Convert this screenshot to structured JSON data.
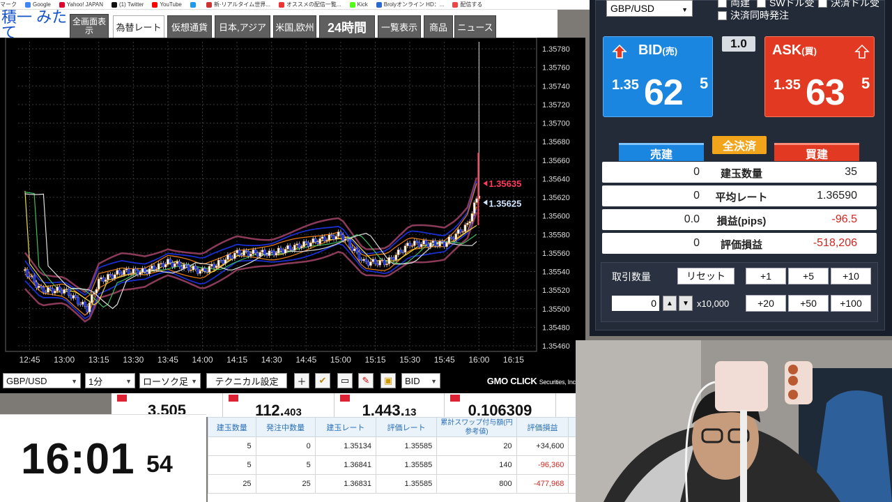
{
  "bookmarks": [
    "マーク",
    "Google",
    "Yahoo! JAPAN",
    "(1) Twitter",
    "YouTube",
    "新·リアルタイム世界...",
    "オススメの配信一覧...",
    "Kick",
    "Brolyオンライン HD：...",
    "配信する"
  ],
  "left_strip_text": "積一 みたて",
  "tabs": [
    {
      "label": "全画面表示"
    },
    {
      "label": "為替レート",
      "active": true
    },
    {
      "label": "仮想通貨"
    },
    {
      "label": "日本,アジア"
    },
    {
      "label": "米国,欧州"
    },
    {
      "label": "24時間"
    },
    {
      "label": "一覧表示"
    },
    {
      "label": "商品"
    },
    {
      "label": "ニュース"
    }
  ],
  "chart": {
    "y_ticks": [
      "1.35780",
      "1.35760",
      "1.35740",
      "1.35720",
      "1.35700",
      "1.35680",
      "1.35660",
      "1.35640",
      "1.35620",
      "1.35600",
      "1.35580",
      "1.35560",
      "1.35540",
      "1.35520",
      "1.35500",
      "1.35480",
      "1.35460"
    ],
    "x_ticks": [
      "12:45",
      "13:00",
      "13:15",
      "13:30",
      "13:45",
      "14:00",
      "14:15",
      "14:30",
      "14:45",
      "15:00",
      "15:15",
      "15:30",
      "15:45",
      "16:00",
      "16:15"
    ],
    "ask_label": "1.35635",
    "bid_label": "1.35625"
  },
  "chart_data": {
    "type": "candlestick",
    "ylim": [
      1.3546,
      1.3578
    ],
    "x_range": [
      "12:40",
      "16:25"
    ],
    "close_path": [
      [
        "12:40",
        1.3555
      ],
      [
        "12:50",
        1.3552
      ],
      [
        "13:00",
        1.3552
      ],
      [
        "13:10",
        1.355
      ],
      [
        "13:15",
        1.3553
      ],
      [
        "13:25",
        1.3554
      ],
      [
        "13:35",
        1.3554
      ],
      [
        "13:45",
        1.3555
      ],
      [
        "14:00",
        1.3554
      ],
      [
        "14:15",
        1.3556
      ],
      [
        "14:30",
        1.3556
      ],
      [
        "14:45",
        1.3557
      ],
      [
        "15:00",
        1.3558
      ],
      [
        "15:10",
        1.3555
      ],
      [
        "15:20",
        1.3555
      ],
      [
        "15:30",
        1.3557
      ],
      [
        "15:45",
        1.3557
      ],
      [
        "15:55",
        1.3559
      ],
      [
        "16:00",
        1.35625
      ]
    ],
    "ask": 1.35635,
    "bid": 1.35625,
    "indicators": [
      "bollinger-bands",
      "moving-averages"
    ],
    "grid": true
  },
  "toolbar": {
    "pair": "GBP/USD",
    "interval": "1分",
    "chart_type": "ローソク足",
    "tech_btn": "テクニカル設定",
    "price_type": "BID",
    "brand_main": "GMO CLICK",
    "brand_sub": "Securities, Inc."
  },
  "rate_strip": [
    {
      "int": "3.505",
      "frac": ""
    },
    {
      "int": "112.",
      "frac": "403"
    },
    {
      "int": "1.443.",
      "frac": "13"
    },
    {
      "int": "0.106309",
      "frac": ""
    }
  ],
  "clock": {
    "hm": "16:01",
    "sec": "54"
  },
  "positions": {
    "headers": [
      "建玉数量",
      "発注中数量",
      "建玉レート",
      "評価レート",
      "累計スワップ付与額(円参考値)",
      "評価損益",
      "通"
    ],
    "rows": [
      [
        "5",
        "0",
        "1.35134",
        "1.35585",
        "20",
        "+34,600"
      ],
      [
        "5",
        "5",
        "1.36841",
        "1.35585",
        "140",
        "-96,360"
      ],
      [
        "25",
        "25",
        "1.36831",
        "1.35585",
        "800",
        "-477,968"
      ]
    ]
  },
  "panel": {
    "pair": "GBP/USD",
    "checks": [
      "両建",
      "SWドル受",
      "決済ドル受",
      "決済同時発注"
    ],
    "bid": {
      "label": "BID",
      "sub": "(売)",
      "pre": "1.35",
      "big": "62",
      "sup": "5"
    },
    "ask": {
      "label": "ASK",
      "sub": "(買)",
      "pre": "1.35",
      "big": "63",
      "sup": "5"
    },
    "lot": "1.0",
    "sell_btn": "売建",
    "close_btn": "全決済",
    "buy_btn": "買建",
    "rows": [
      {
        "l": "0",
        "m": "建玉数量",
        "r": "35"
      },
      {
        "l": "0",
        "m": "平均レート",
        "r": "1.36590"
      },
      {
        "l": "0.0",
        "m": "損益(pips)",
        "r": "-96.5",
        "neg": true
      },
      {
        "l": "0",
        "m": "評価損益",
        "r": "-518,206",
        "neg": true
      }
    ],
    "qty_label": "取引数量",
    "reset": "リセット",
    "plus_row1": [
      "+1",
      "+5",
      "+10"
    ],
    "plus_row2": [
      "+20",
      "+50",
      "+100"
    ],
    "qty_value": "0",
    "qty_unit": "x10,000"
  },
  "colors": {
    "bid": "#1b86e0",
    "ask": "#e23a22",
    "ask_line": "#ff3b5b",
    "bid_line": "#cfe6ff"
  }
}
